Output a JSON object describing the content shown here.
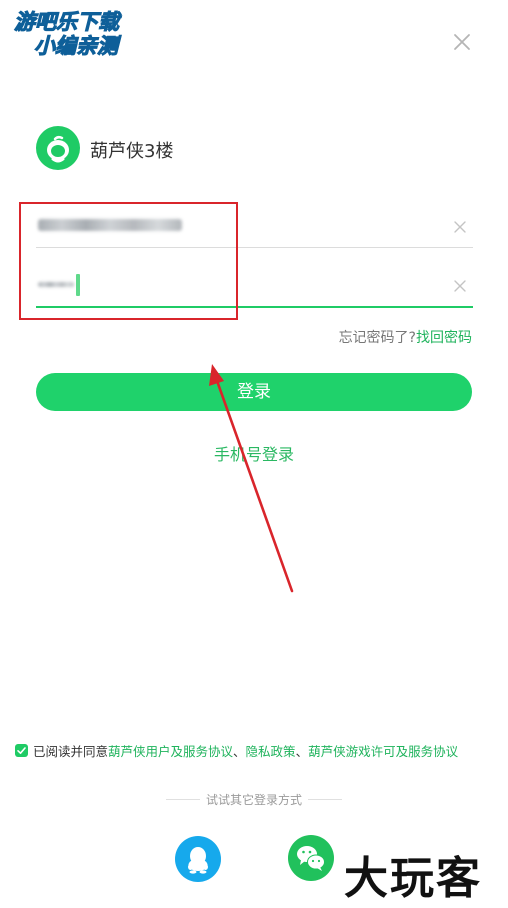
{
  "watermark_top": {
    "line1": "游吧乐下载",
    "line2": "小编亲测"
  },
  "app": {
    "name": "葫芦侠3楼"
  },
  "forgot": {
    "question": "忘记密码了?",
    "link": "找回密码"
  },
  "login_button": "登录",
  "phone_login": "手机号登录",
  "agreement": {
    "prefix": "已阅读并同意",
    "user_agreement": "葫芦侠用户及服务协议",
    "sep1": "、",
    "privacy": "隐私政策",
    "sep2": "、",
    "game_license": "葫芦侠游戏许可及服务协议"
  },
  "other_login": "试试其它登录方式",
  "watermark_bottom": "大玩客",
  "colors": {
    "accent": "#1fd26b",
    "link": "#1fb35c",
    "annotation": "#d9252b",
    "qq": "#16a9ec",
    "wechat": "#21c15c"
  },
  "icons": [
    "close-icon",
    "app-logo-icon",
    "clear-icon",
    "checkbox-icon",
    "qq-icon",
    "wechat-icon"
  ]
}
